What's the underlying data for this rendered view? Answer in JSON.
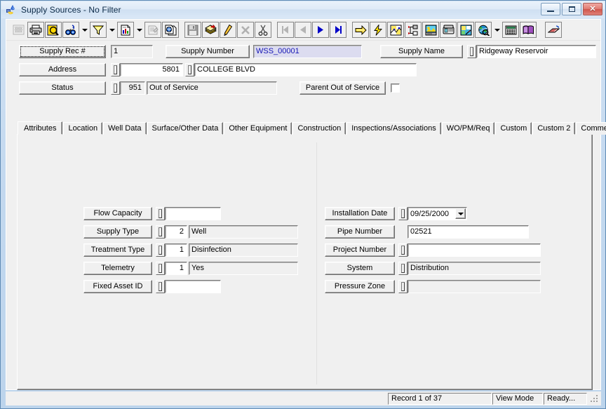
{
  "window": {
    "title": "Supply Sources - No Filter",
    "icon": "water-supply-icon",
    "minimize_label": "Minimize",
    "maximize_label": "Maximize",
    "close_label": "Close"
  },
  "toolbar": {
    "buttons": [
      {
        "name": "grid-view-button",
        "icon": "grid-icon",
        "disabled": true,
        "framed": false
      },
      {
        "name": "print-button",
        "icon": "printer-icon",
        "disabled": false,
        "framed": true
      },
      {
        "name": "print-preview-button",
        "icon": "preview-icon",
        "disabled": false,
        "framed": true
      },
      {
        "name": "find-button",
        "icon": "binoculars-icon",
        "disabled": false,
        "framed": true
      },
      {
        "name": "find-dropdown",
        "icon": "chevron-down-icon",
        "dropdown": true
      },
      {
        "name": "filter-button",
        "icon": "funnel-icon",
        "disabled": false,
        "framed": true
      },
      {
        "name": "filter-dropdown",
        "icon": "chevron-down-icon",
        "dropdown": true
      },
      {
        "name": "report-button",
        "icon": "report-icon",
        "disabled": false,
        "framed": true
      },
      {
        "name": "report-dropdown",
        "icon": "chevron-down-icon",
        "dropdown": true
      },
      {
        "name": "properties-button",
        "icon": "properties-icon",
        "disabled": true,
        "framed": true
      },
      {
        "name": "copy-record-button",
        "icon": "copy-record-icon",
        "disabled": false,
        "framed": true
      },
      {
        "name": "separator-1",
        "icon": "separator"
      },
      {
        "name": "save-button",
        "icon": "save-icon",
        "disabled": true,
        "framed": true
      },
      {
        "name": "new-record-button",
        "icon": "new-record-icon",
        "disabled": false,
        "framed": true
      },
      {
        "name": "edit-record-button",
        "icon": "pencil-icon",
        "disabled": false,
        "framed": true
      },
      {
        "name": "delete-record-button",
        "icon": "delete-x-icon",
        "disabled": true,
        "framed": true
      },
      {
        "name": "cut-button",
        "icon": "scissors-icon",
        "disabled": false,
        "framed": true
      },
      {
        "name": "separator-2",
        "icon": "separator"
      },
      {
        "name": "first-record-button",
        "icon": "first-record-icon",
        "disabled": true,
        "framed": true
      },
      {
        "name": "previous-record-button",
        "icon": "prev-record-icon",
        "disabled": true,
        "framed": true
      },
      {
        "name": "next-record-button",
        "icon": "next-record-icon",
        "disabled": false,
        "framed": true
      },
      {
        "name": "last-record-button",
        "icon": "last-record-icon",
        "disabled": false,
        "framed": true
      },
      {
        "name": "separator-3",
        "icon": "separator"
      },
      {
        "name": "goto-button",
        "icon": "yellow-arrow-icon",
        "disabled": false,
        "framed": true
      },
      {
        "name": "quick-action-button",
        "icon": "lightning-icon",
        "disabled": false,
        "framed": true
      },
      {
        "name": "map-view-button",
        "icon": "map-icon",
        "disabled": false,
        "framed": true
      },
      {
        "name": "hierarchy-button",
        "icon": "hierarchy-icon",
        "disabled": false,
        "framed": true
      },
      {
        "name": "workstation-button",
        "icon": "workstation-icon",
        "disabled": false,
        "framed": true
      },
      {
        "name": "telephone-button",
        "icon": "telephone-icon",
        "disabled": false,
        "framed": true
      },
      {
        "name": "gis-button",
        "icon": "gis-icon",
        "disabled": false,
        "framed": true
      },
      {
        "name": "globe-search-button",
        "icon": "globe-icon",
        "disabled": false,
        "framed": true
      },
      {
        "name": "globe-dropdown",
        "icon": "chevron-down-icon",
        "dropdown": true
      },
      {
        "name": "calculator-button",
        "icon": "calculator-icon",
        "disabled": false,
        "framed": true
      },
      {
        "name": "help-book-button",
        "icon": "book-icon",
        "disabled": false,
        "framed": true
      },
      {
        "name": "separator-4",
        "icon": "separator"
      },
      {
        "name": "exit-button",
        "icon": "exit-icon",
        "disabled": false,
        "framed": true
      }
    ]
  },
  "header": {
    "supply_rec_label": "Supply Rec #",
    "supply_rec_value": "1",
    "supply_number_label": "Supply Number",
    "supply_number_value": "WSS_00001",
    "supply_name_label": "Supply Name",
    "supply_name_value": "Ridgeway Reservoir",
    "address_label": "Address",
    "address_number_value": "5801",
    "address_street_value": "COLLEGE BLVD",
    "status_label": "Status",
    "status_code_value": "951",
    "status_text_value": "Out of Service",
    "parent_out_of_service_label": "Parent Out of Service",
    "parent_out_of_service_checked": false
  },
  "tabs": [
    {
      "label": "Attributes",
      "active": true
    },
    {
      "label": "Location",
      "active": false
    },
    {
      "label": "Well Data",
      "active": false
    },
    {
      "label": "Surface/Other Data",
      "active": false
    },
    {
      "label": "Other Equipment",
      "active": false
    },
    {
      "label": "Construction",
      "active": false
    },
    {
      "label": "Inspections/Associations",
      "active": false
    },
    {
      "label": "WO/PM/Req",
      "active": false
    },
    {
      "label": "Custom",
      "active": false
    },
    {
      "label": "Custom 2",
      "active": false
    },
    {
      "label": "Comments",
      "active": false
    }
  ],
  "attributes": {
    "left_fields": [
      {
        "label": "Flow Capacity",
        "has_lookup": true,
        "code": "",
        "value": "",
        "value_readonly": false,
        "has_code": false
      },
      {
        "label": "Supply Type",
        "has_lookup": true,
        "code": "2",
        "value": "Well",
        "value_readonly": true,
        "has_code": true
      },
      {
        "label": "Treatment Type",
        "has_lookup": true,
        "code": "1",
        "value": "Disinfection",
        "value_readonly": true,
        "has_code": true
      },
      {
        "label": "Telemetry",
        "has_lookup": true,
        "code": "1",
        "value": "Yes",
        "value_readonly": true,
        "has_code": true
      },
      {
        "label": "Fixed Asset ID",
        "has_lookup": true,
        "code": "",
        "value": "",
        "value_readonly": false,
        "has_code": false
      }
    ],
    "right_fields": [
      {
        "label": "Installation Date",
        "has_lookup": true,
        "value": "09/25/2000",
        "type": "date",
        "value_readonly": false
      },
      {
        "label": "Pipe Number",
        "has_lookup": false,
        "value": "02521",
        "type": "text",
        "value_readonly": false
      },
      {
        "label": "Project Number",
        "has_lookup": true,
        "value": "",
        "type": "text",
        "value_readonly": false
      },
      {
        "label": "System",
        "has_lookup": true,
        "value": "Distribution",
        "type": "text",
        "value_readonly": true
      },
      {
        "label": "Pressure Zone",
        "has_lookup": true,
        "value": "",
        "type": "text",
        "value_readonly": true
      }
    ]
  },
  "statusbar": {
    "record_text": "Record 1 of 37",
    "mode_text": "View Mode",
    "ready_text": "Ready..."
  },
  "colors": {
    "face": "#f0f0f0",
    "keyfield_bg": "#dcdcf0",
    "keyfield_fg": "#1414b4",
    "accent_blue": "#0000cc",
    "accent_yellow": "#ffd700"
  }
}
